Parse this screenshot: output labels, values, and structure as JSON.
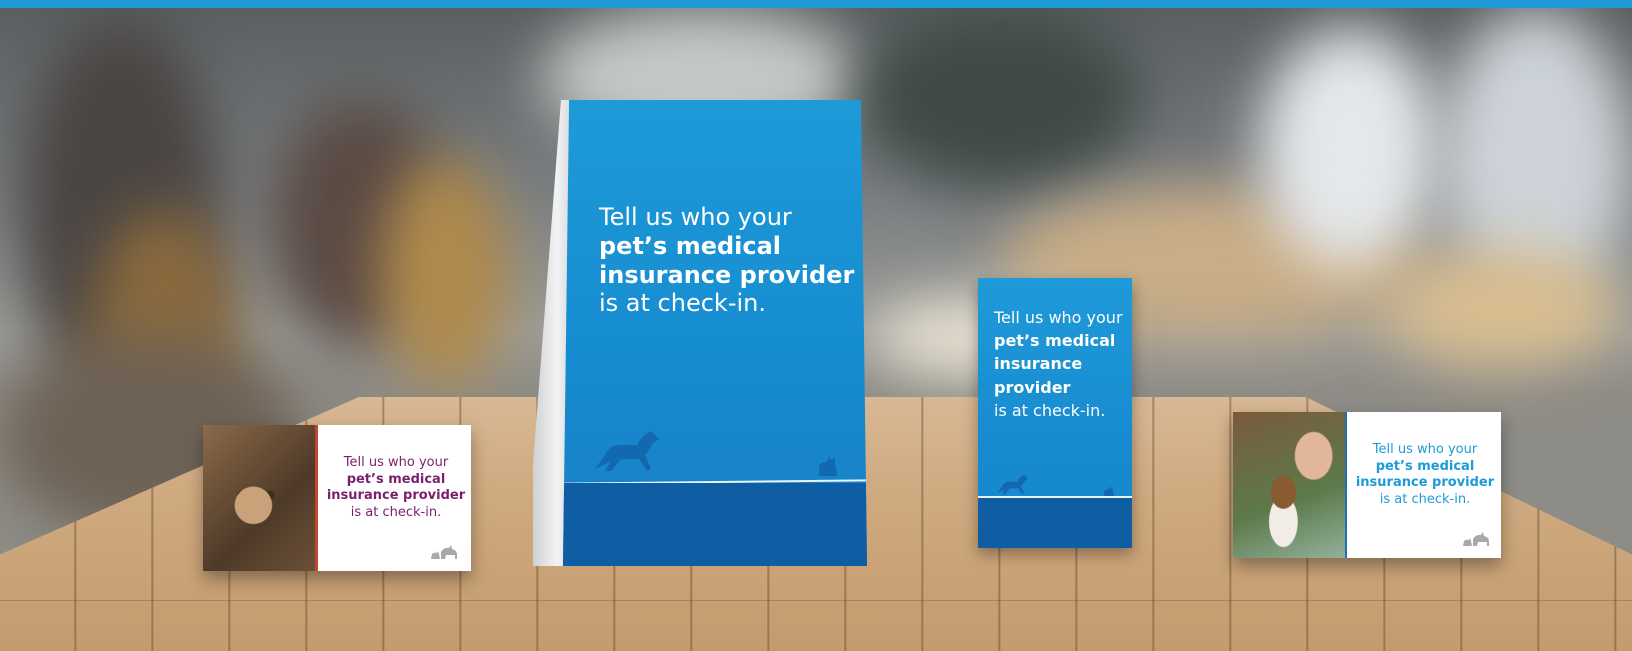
{
  "colors": {
    "brand_blue": "#1e9ad9",
    "dark_blue": "#0f5ea4",
    "purple_text": "#7b1f6e",
    "light_blue_text": "#1e9ad9"
  },
  "tent_card": {
    "line1": "Tell us who your",
    "line2": "pet’s medical",
    "line3": "insurance provider",
    "line4": "is at check-in."
  },
  "small_card": {
    "line1": "Tell us who your",
    "line2": "pet’s medical",
    "line3": "insurance",
    "line4": "provider",
    "line5": "is at check-in."
  },
  "left_card": {
    "line1": "Tell us who your",
    "line2": "pet’s medical",
    "line3": "insurance provider",
    "line4": "is at check-in."
  },
  "right_card": {
    "line1": "Tell us who your",
    "line2": "pet’s medical",
    "line3": "insurance provider",
    "line4": "is at check-in."
  },
  "icons": {
    "dog": "dog-silhouette-icon",
    "cat": "cat-silhouette-icon",
    "logo": "dog-cat-logo-icon"
  }
}
